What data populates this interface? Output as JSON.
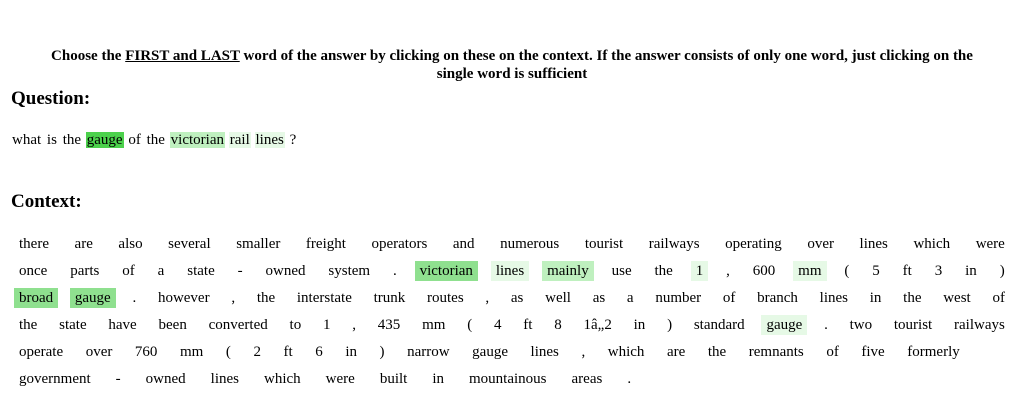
{
  "instruction": {
    "prefix": "Choose the ",
    "emphasis": "FIRST and LAST",
    "rest": " word of the answer by clicking on these on the context. If the answer consists of only one word, just clicking on the",
    "line2": "single word is sufficient"
  },
  "question_heading": "Question:",
  "question": {
    "words": [
      {
        "text": "what",
        "hl": 0
      },
      {
        "text": "is",
        "hl": 0
      },
      {
        "text": "the",
        "hl": 0
      },
      {
        "text": "gauge",
        "hl": 4
      },
      {
        "text": "of",
        "hl": 0
      },
      {
        "text": "the",
        "hl": 0
      },
      {
        "text": "victorian",
        "hl": 2
      },
      {
        "text": "rail",
        "hl": 1
      },
      {
        "text": "lines",
        "hl": 1
      },
      {
        "text": "?",
        "hl": 0
      }
    ]
  },
  "context_heading": "Context:",
  "context": {
    "lines": [
      [
        {
          "text": "there",
          "hl": 0
        },
        {
          "text": "are",
          "hl": 0
        },
        {
          "text": "also",
          "hl": 0
        },
        {
          "text": "several",
          "hl": 0
        },
        {
          "text": "smaller",
          "hl": 0
        },
        {
          "text": "freight",
          "hl": 0
        },
        {
          "text": "operators",
          "hl": 0
        },
        {
          "text": "and",
          "hl": 0
        },
        {
          "text": "numerous",
          "hl": 0
        },
        {
          "text": "tourist",
          "hl": 0
        },
        {
          "text": "railways",
          "hl": 0
        },
        {
          "text": "operating",
          "hl": 0
        },
        {
          "text": "over",
          "hl": 0
        },
        {
          "text": "lines",
          "hl": 0
        },
        {
          "text": "which",
          "hl": 0
        },
        {
          "text": "were",
          "hl": 0
        }
      ],
      [
        {
          "text": "once",
          "hl": 0
        },
        {
          "text": "parts",
          "hl": 0
        },
        {
          "text": "of",
          "hl": 0
        },
        {
          "text": "a",
          "hl": 0
        },
        {
          "text": "state",
          "hl": 0
        },
        {
          "text": "-",
          "hl": 0
        },
        {
          "text": "owned",
          "hl": 0
        },
        {
          "text": "system",
          "hl": 0
        },
        {
          "text": ".",
          "hl": 0
        },
        {
          "text": "victorian",
          "hl": 3
        },
        {
          "text": "lines",
          "hl": 1
        },
        {
          "text": "mainly",
          "hl": 2
        },
        {
          "text": "use",
          "hl": 0
        },
        {
          "text": "the",
          "hl": 0
        },
        {
          "text": "1",
          "hl": 1
        },
        {
          "text": ",",
          "hl": 0
        },
        {
          "text": "600",
          "hl": 0
        },
        {
          "text": "mm",
          "hl": 1
        },
        {
          "text": "(",
          "hl": 0
        },
        {
          "text": "5",
          "hl": 0
        },
        {
          "text": "ft",
          "hl": 0
        },
        {
          "text": "3",
          "hl": 0
        },
        {
          "text": "in",
          "hl": 0
        },
        {
          "text": ")",
          "hl": 0
        }
      ],
      [
        {
          "text": "broad",
          "hl": 3
        },
        {
          "text": "gauge",
          "hl": 3
        },
        {
          "text": ".",
          "hl": 0
        },
        {
          "text": "however",
          "hl": 0
        },
        {
          "text": ",",
          "hl": 0
        },
        {
          "text": "the",
          "hl": 0
        },
        {
          "text": "interstate",
          "hl": 0
        },
        {
          "text": "trunk",
          "hl": 0
        },
        {
          "text": "routes",
          "hl": 0
        },
        {
          "text": ",",
          "hl": 0
        },
        {
          "text": "as",
          "hl": 0
        },
        {
          "text": "well",
          "hl": 0
        },
        {
          "text": "as",
          "hl": 0
        },
        {
          "text": "a",
          "hl": 0
        },
        {
          "text": "number",
          "hl": 0
        },
        {
          "text": "of",
          "hl": 0
        },
        {
          "text": "branch",
          "hl": 0
        },
        {
          "text": "lines",
          "hl": 0
        },
        {
          "text": "in",
          "hl": 0
        },
        {
          "text": "the",
          "hl": 0
        },
        {
          "text": "west",
          "hl": 0
        },
        {
          "text": "of",
          "hl": 0
        }
      ],
      [
        {
          "text": "the",
          "hl": 0
        },
        {
          "text": "state",
          "hl": 0
        },
        {
          "text": "have",
          "hl": 0
        },
        {
          "text": "been",
          "hl": 0
        },
        {
          "text": "converted",
          "hl": 0
        },
        {
          "text": "to",
          "hl": 0
        },
        {
          "text": "1",
          "hl": 0
        },
        {
          "text": ",",
          "hl": 0
        },
        {
          "text": "435",
          "hl": 0
        },
        {
          "text": "mm",
          "hl": 0
        },
        {
          "text": "(",
          "hl": 0
        },
        {
          "text": "4",
          "hl": 0
        },
        {
          "text": "ft",
          "hl": 0
        },
        {
          "text": "8",
          "hl": 0
        },
        {
          "text": "1â„2",
          "hl": 0
        },
        {
          "text": "in",
          "hl": 0
        },
        {
          "text": ")",
          "hl": 0
        },
        {
          "text": "standard",
          "hl": 0
        },
        {
          "text": "gauge",
          "hl": 1
        },
        {
          "text": ".",
          "hl": 0
        },
        {
          "text": "two",
          "hl": 0
        },
        {
          "text": "tourist",
          "hl": 0
        },
        {
          "text": "railways",
          "hl": 0
        }
      ],
      [
        {
          "text": "operate",
          "hl": 0
        },
        {
          "text": "over",
          "hl": 0
        },
        {
          "text": "760",
          "hl": 0
        },
        {
          "text": "mm",
          "hl": 0
        },
        {
          "text": "(",
          "hl": 0
        },
        {
          "text": "2",
          "hl": 0
        },
        {
          "text": "ft",
          "hl": 0
        },
        {
          "text": "6",
          "hl": 0
        },
        {
          "text": "in",
          "hl": 0
        },
        {
          "text": ")",
          "hl": 0
        },
        {
          "text": "narrow",
          "hl": 0
        },
        {
          "text": "gauge",
          "hl": 0
        },
        {
          "text": "lines",
          "hl": 0
        },
        {
          "text": ",",
          "hl": 0
        },
        {
          "text": "which",
          "hl": 0
        },
        {
          "text": "are",
          "hl": 0
        },
        {
          "text": "the",
          "hl": 0
        },
        {
          "text": "remnants",
          "hl": 0
        },
        {
          "text": "of",
          "hl": 0
        },
        {
          "text": "five",
          "hl": 0
        },
        {
          "text": "formerly",
          "hl": 0
        },
        {
          "text": "",
          "hl": 0
        },
        {
          "text": "",
          "hl": 0
        }
      ],
      [
        {
          "text": "government",
          "hl": 0
        },
        {
          "text": "-",
          "hl": 0
        },
        {
          "text": "owned",
          "hl": 0
        },
        {
          "text": "lines",
          "hl": 0
        },
        {
          "text": "which",
          "hl": 0
        },
        {
          "text": "were",
          "hl": 0
        },
        {
          "text": "built",
          "hl": 0
        },
        {
          "text": "in",
          "hl": 0
        },
        {
          "text": "mountainous",
          "hl": 0
        },
        {
          "text": "areas",
          "hl": 0
        },
        {
          "text": ".",
          "hl": 0
        }
      ]
    ]
  },
  "highlight_colors": {
    "1": "#e6f9e6",
    "2": "#bff0bf",
    "3": "#8fe08f",
    "4": "#4cd14c"
  }
}
